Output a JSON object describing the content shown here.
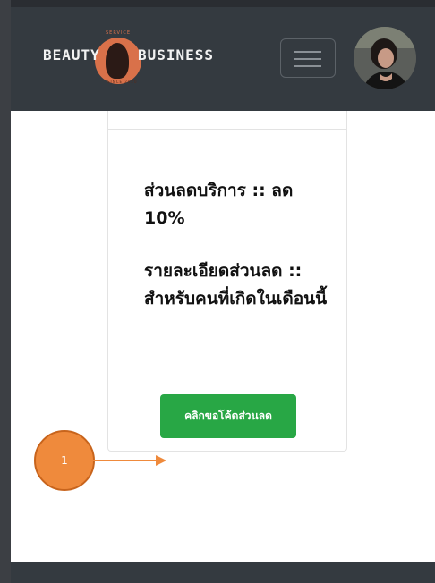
{
  "navbar": {
    "logo_left": "BEAUTY",
    "logo_right": "BUSINESS",
    "logo_service": "SERVICE",
    "logo_since": "SINCE 2020",
    "menu_icon": "hamburger-icon",
    "avatar_icon": "avatar"
  },
  "card": {
    "discount": "ส่วนลดบริการ :: ลด 10%",
    "details": "รายละเอียดส่วนลด :: สำหรับคนที่เกิดในเดือนนี้",
    "button_label": "คลิกขอโค้ดส่วนลด"
  },
  "annotation": {
    "number": "1",
    "color": "#ef8a3c"
  },
  "colors": {
    "navbar": "#343a40",
    "button": "#28a745"
  }
}
